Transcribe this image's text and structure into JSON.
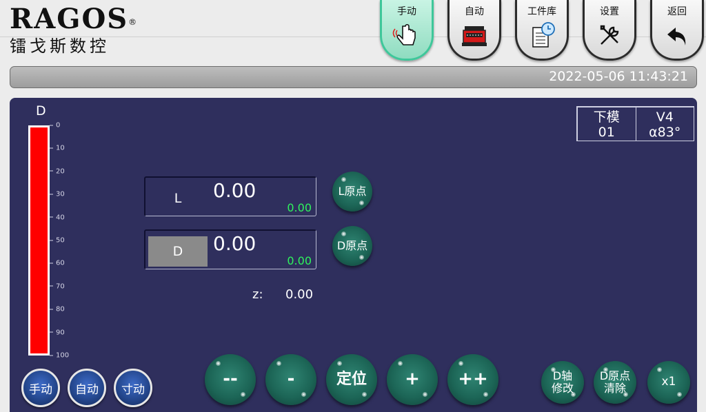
{
  "header": {
    "brand_logo": "RAGOS",
    "brand_registered": "®",
    "brand_subtitle": "镭戈斯数控"
  },
  "nav": {
    "manual": "手动",
    "auto": "自动",
    "library": "工件库",
    "settings": "设置",
    "back": "返回"
  },
  "status": {
    "datetime": "2022-05-06 11:43:21"
  },
  "gauge": {
    "title": "D",
    "fill_fraction": 1.0,
    "ticks": [
      "0",
      "10",
      "20",
      "30",
      "40",
      "50",
      "60",
      "70",
      "80",
      "90",
      "100"
    ]
  },
  "mold": {
    "lower_label": "下模",
    "lower_value": "01",
    "v_label": "V4",
    "angle": "α83°"
  },
  "axes": {
    "L": {
      "label": "L",
      "value": "0.00",
      "small": "0.00",
      "origin_button": "L原点"
    },
    "D": {
      "label": "D",
      "value": "0.00",
      "small": "0.00",
      "origin_button": "D原点"
    }
  },
  "z": {
    "label": "z:",
    "value": "0.00"
  },
  "controls": {
    "fast_minus": "--",
    "minus": "-",
    "position": "定位",
    "plus": "+",
    "fast_plus": "++",
    "d_axis_modify_1": "D轴",
    "d_axis_modify_2": "修改",
    "d_origin_clear_1": "D原点",
    "d_origin_clear_2": "清除",
    "multiplier": "x1"
  },
  "modes": {
    "manual": "手动",
    "auto": "自动",
    "jog": "寸动"
  },
  "colors": {
    "panel": "#2f2f5d",
    "gauge_fill": "#ff0000",
    "small_value": "#2ff35d",
    "active_nav": "#3ec79a"
  }
}
